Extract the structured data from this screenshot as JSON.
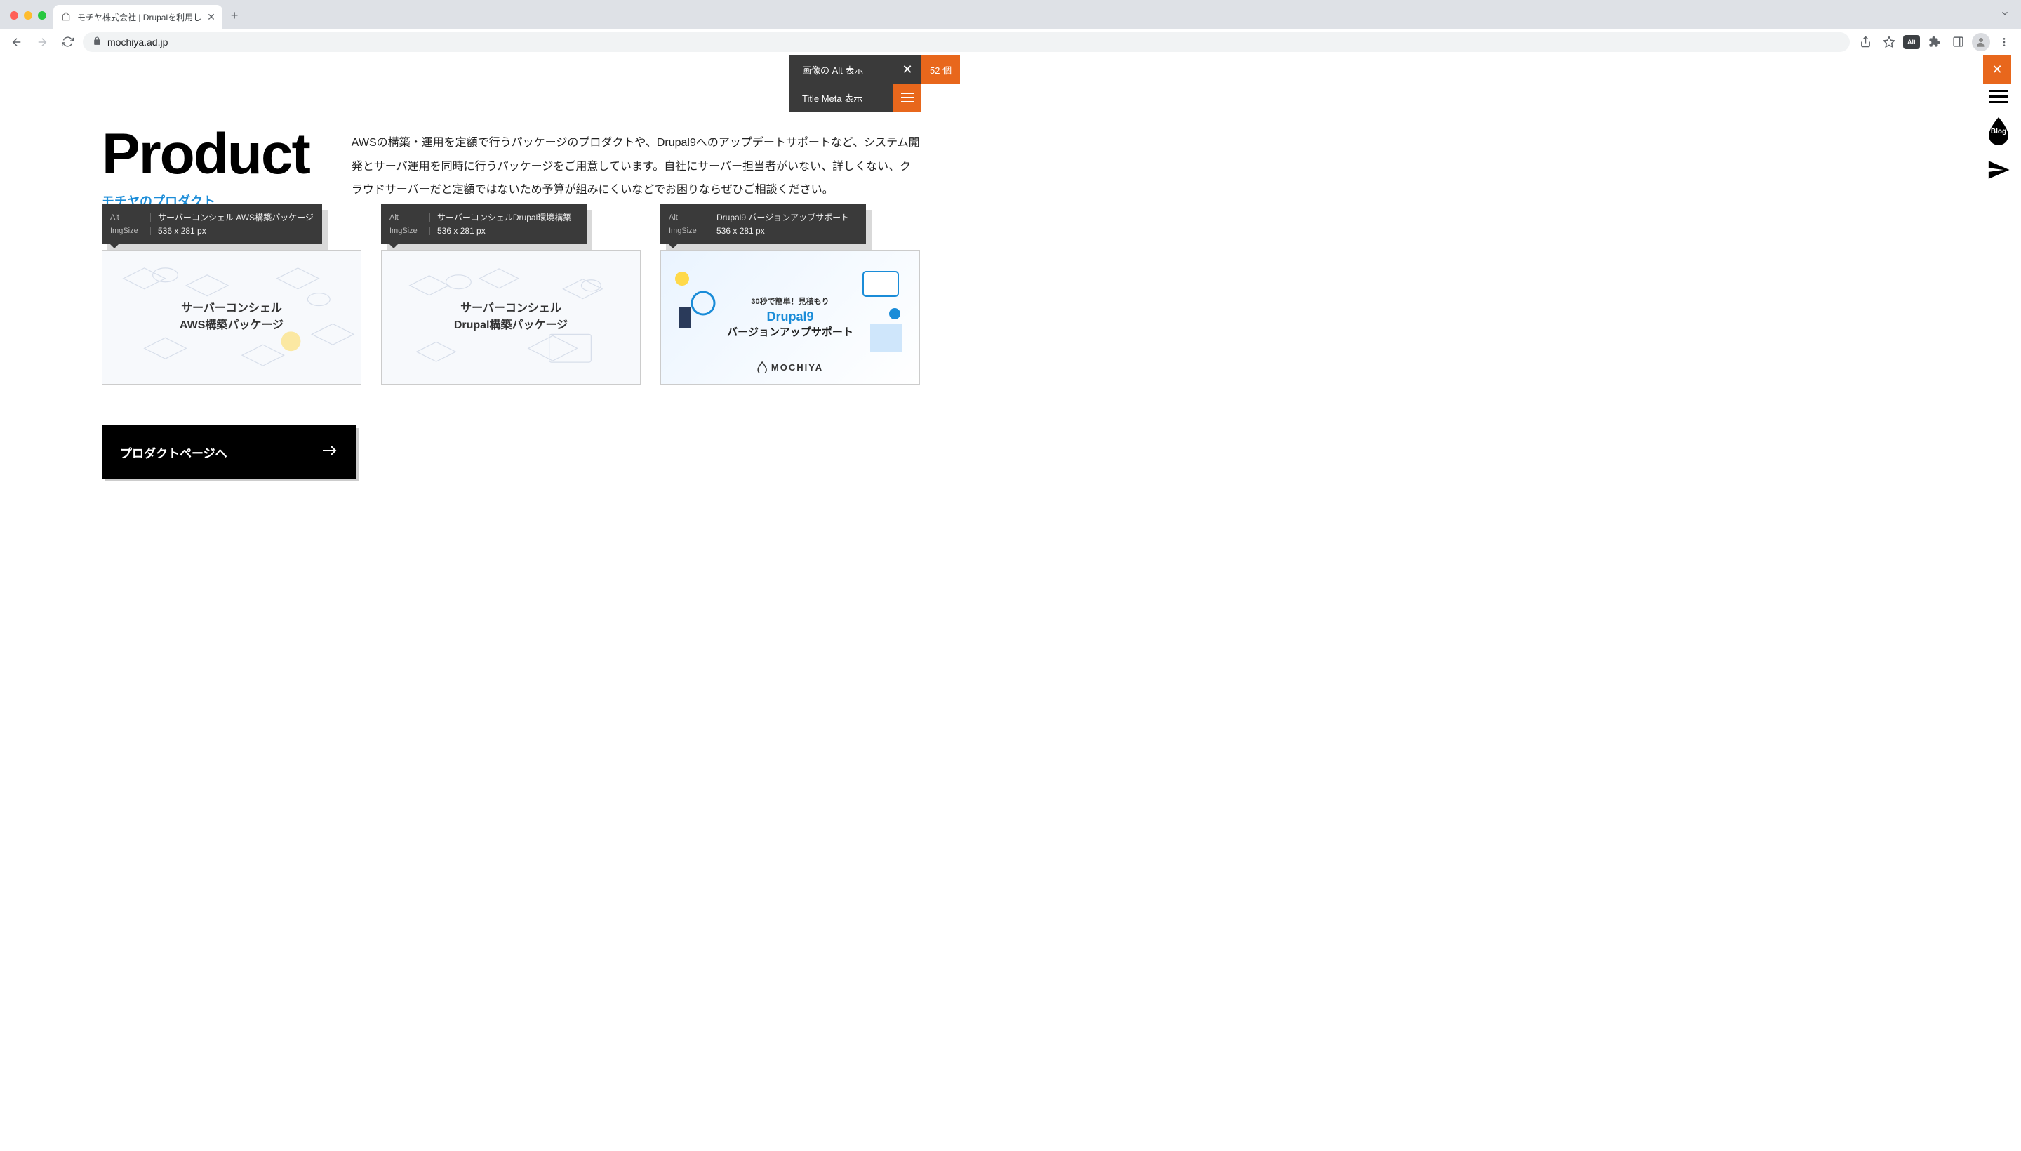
{
  "browser": {
    "tab_title": "モチヤ株式会社 | Drupalを利用し",
    "url": "mochiya.ad.jp"
  },
  "extension": {
    "alt_display_label": "画像の Alt 表示",
    "title_meta_label": "Title Meta 表示",
    "count_text": "52 個",
    "ext_badge_text": "Alt"
  },
  "floating": {
    "blog_label": "Blog"
  },
  "hero": {
    "heading": "Product",
    "subtitle": "モチヤのプロダクト",
    "paragraph": "AWSの構築・運用を定額で行うパッケージのプロダクトや、Drupal9へのアップデートサポートなど、システム開発とサーバ運用を同時に行うパッケージをご用意しています。自社にサーバー担当者がいない、詳しくない、クラウドサーバーだと定額ではないため予算が組みにくいなどでお困りならぜひご相談ください。"
  },
  "cards": [
    {
      "alt_key": "Alt",
      "alt_val": "サーバーコンシェル AWS構築パッケージ",
      "size_key": "ImgSize",
      "size_val": "536 x 281 px",
      "img_line1": "サーバーコンシェル",
      "img_line2": "AWS構築パッケージ"
    },
    {
      "alt_key": "Alt",
      "alt_val": "サーバーコンシェルDrupal環境構築",
      "size_key": "ImgSize",
      "size_val": "536 x 281 px",
      "img_line1": "サーバーコンシェル",
      "img_line2": "Drupal構築パッケージ"
    },
    {
      "alt_key": "Alt",
      "alt_val": "Drupal9 バージョンアップサポート",
      "size_key": "ImgSize",
      "size_val": "536 x 281 px",
      "badge": "30秒で簡単！見積もり",
      "title1": "Drupal9",
      "title2": "バージョンアップサポート",
      "brand": "MOCHIYA"
    }
  ],
  "cta": {
    "label": "プロダクトページへ"
  }
}
